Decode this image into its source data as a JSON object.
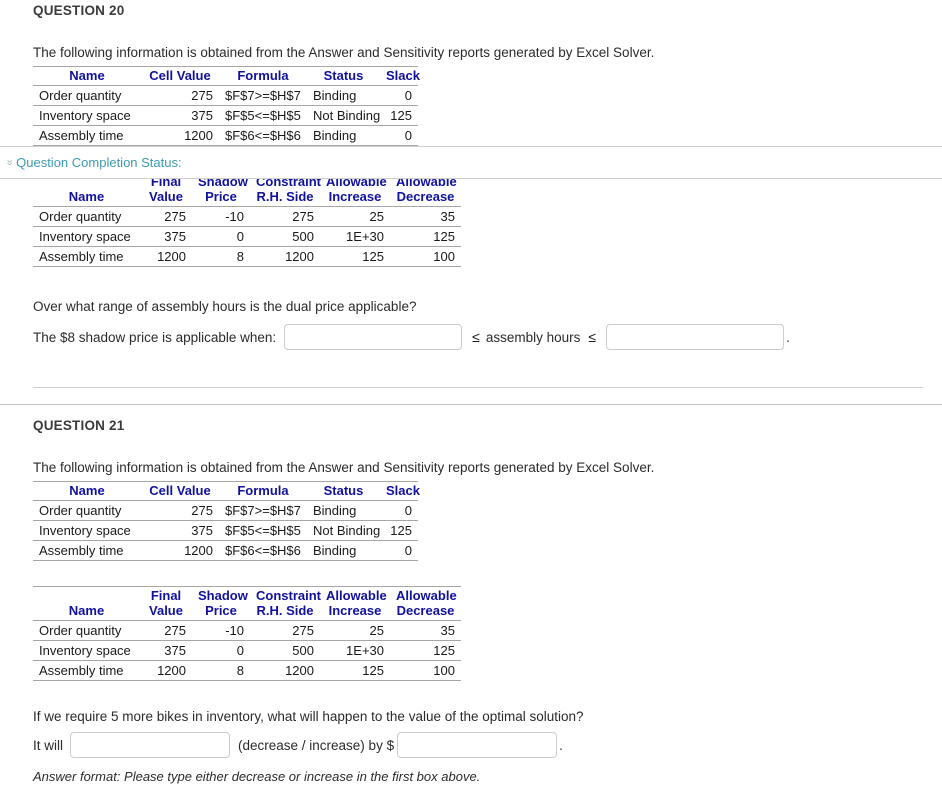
{
  "status_bar": {
    "label": "Question Completion Status:",
    "chevron_icon": "double-chevron-down-icon",
    "link_color": "#3a9cb0"
  },
  "theme": {
    "header_blue": "#11119e",
    "body_text": "#2b2b2b",
    "rule_gray": "#a6a6a6",
    "input_border": "#ccccd0"
  },
  "questions": [
    {
      "title": "QUESTION 20",
      "intro": "The following information is obtained from the Answer and Sensitivity reports generated by Excel Solver.",
      "answer_table": {
        "headers": [
          "Name",
          "Cell Value",
          "Formula",
          "Status",
          "Slack"
        ],
        "rows": [
          [
            "Order quantity",
            "275",
            "$F$7>=$H$7",
            "Binding",
            "0"
          ],
          [
            "Inventory space",
            "375",
            "$F$5<=$H$5",
            "Not Binding",
            "125"
          ],
          [
            "Assembly time",
            "1200",
            "$F$6<=$H$6",
            "Binding",
            "0"
          ]
        ]
      },
      "sensitivity_table": {
        "headers_top": [
          "",
          "Final",
          "Shadow",
          "Constraint",
          "Allowable",
          "Allowable"
        ],
        "headers_bottom": [
          "Name",
          "Value",
          "Price",
          "R.H. Side",
          "Increase",
          "Decrease"
        ],
        "rows": [
          [
            "Order quantity",
            "275",
            "-10",
            "275",
            "25",
            "35"
          ],
          [
            "Inventory space",
            "375",
            "0",
            "500",
            "1E+30",
            "125"
          ],
          [
            "Assembly time",
            "1200",
            "8",
            "1200",
            "125",
            "100"
          ]
        ]
      },
      "prompt": "Over what range of assembly hours is the dual price applicable?",
      "answer_prefix": "The $8 shadow price is applicable when:",
      "answer_mid": "assembly hours",
      "answer_suffix": ".",
      "inequality_symbol": "≤",
      "input_low": {
        "value": "",
        "placeholder": ""
      },
      "input_high": {
        "value": "",
        "placeholder": ""
      }
    },
    {
      "title": "QUESTION 21",
      "intro": "The following information is obtained from the Answer and Sensitivity reports generated by Excel Solver.",
      "answer_table": {
        "headers": [
          "Name",
          "Cell Value",
          "Formula",
          "Status",
          "Slack"
        ],
        "rows": [
          [
            "Order quantity",
            "275",
            "$F$7>=$H$7",
            "Binding",
            "0"
          ],
          [
            "Inventory space",
            "375",
            "$F$5<=$H$5",
            "Not Binding",
            "125"
          ],
          [
            "Assembly time",
            "1200",
            "$F$6<=$H$6",
            "Binding",
            "0"
          ]
        ]
      },
      "sensitivity_table": {
        "headers_top": [
          "",
          "Final",
          "Shadow",
          "Constraint",
          "Allowable",
          "Allowable"
        ],
        "headers_bottom": [
          "Name",
          "Value",
          "Price",
          "R.H. Side",
          "Increase",
          "Decrease"
        ],
        "rows": [
          [
            "Order quantity",
            "275",
            "-10",
            "275",
            "25",
            "35"
          ],
          [
            "Inventory space",
            "375",
            "0",
            "500",
            "1E+30",
            "125"
          ],
          [
            "Assembly time",
            "1200",
            "8",
            "1200",
            "125",
            "100"
          ]
        ]
      },
      "prompt": "If we require 5 more bikes in inventory, what will happen to the value of the optimal solution?",
      "answer_prefix": "It will",
      "answer_mid": "(decrease / increase) by $",
      "answer_suffix": ".",
      "input_direction": {
        "value": "",
        "placeholder": ""
      },
      "input_amount": {
        "value": "",
        "placeholder": ""
      },
      "format_note": "Answer format: Please type either decrease or increase in the first box above."
    }
  ]
}
